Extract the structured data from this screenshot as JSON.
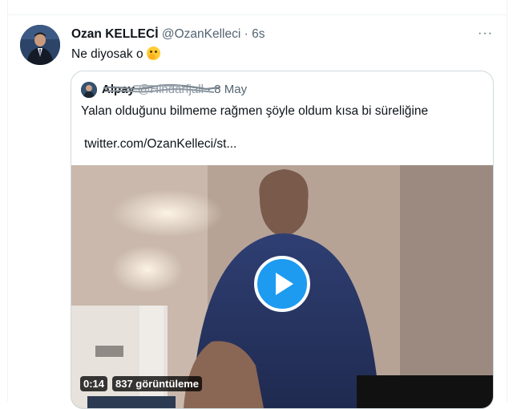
{
  "tweet": {
    "author_name": "Ozan KELLECİ",
    "author_handle": "@OzanKelleci",
    "separator": "·",
    "time": "6s",
    "text": "Ne diyosak o",
    "emoji_icon": "melting-face-emoji",
    "more_icon": "more-dots-icon",
    "more_label": "···"
  },
  "quoted": {
    "author_name": "Alpay",
    "author_handle": "@Hindarfjall",
    "separator": "·",
    "time": "8 May",
    "text": "Yalan olduğunu bilmeme rağmen şöyle oldum kısa bi süreliğine",
    "link": "twitter.com/OzanKelleci/st...",
    "video": {
      "duration": "0:14",
      "views": "837 görüntüleme",
      "play_icon": "play-icon"
    }
  },
  "colors": {
    "accent": "#1d9bf0",
    "text": "#0f1419",
    "muted": "#536471",
    "border": "#cfd9de"
  }
}
